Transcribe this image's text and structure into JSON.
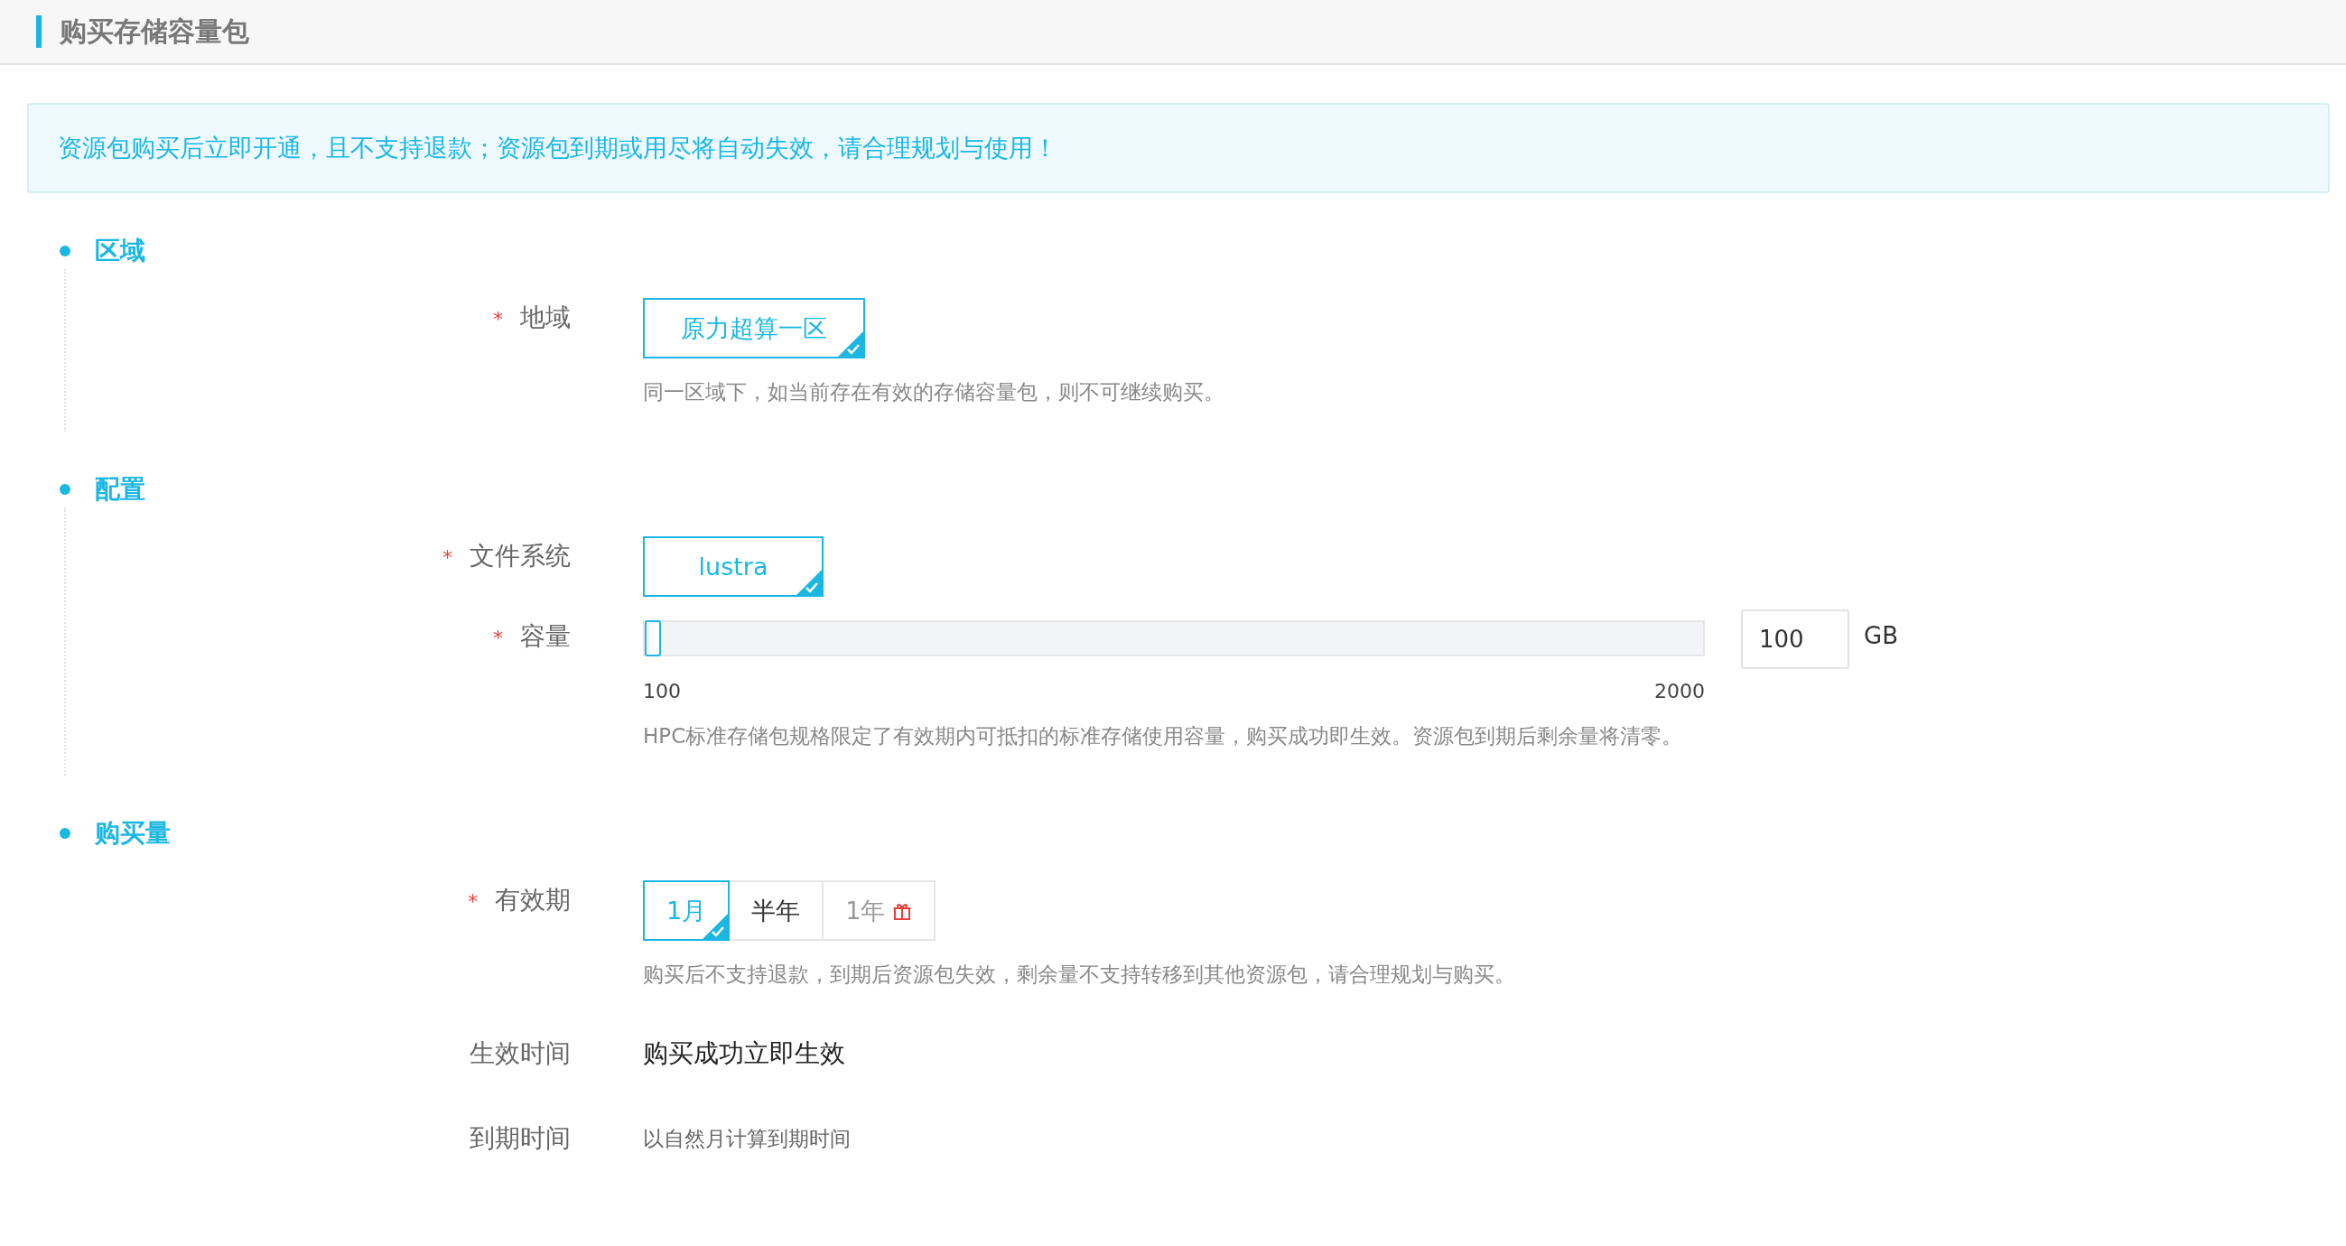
{
  "page_title": "购买存储容量包",
  "notice": "资源包购买后立即开通，且不支持退款；资源包到期或用尽将自动失效，请合理规划与使用！",
  "sections": [
    {
      "title": "区域",
      "fields": [
        {
          "kind": "choice",
          "label": "地域",
          "required_mark": "*",
          "options": [
            {
              "label": "原力超算一区",
              "selected": true,
              "disabled": false,
              "gift": false
            }
          ],
          "hint": "同一区域下，如当前存在有效的存储容量包，则不可继续购买。"
        }
      ]
    },
    {
      "title": "配置",
      "fields": [
        {
          "kind": "choice",
          "label": "文件系统",
          "required_mark": "*",
          "options": [
            {
              "label": "lustra",
              "selected": true,
              "disabled": false,
              "gift": false
            }
          ]
        },
        {
          "kind": "slider",
          "label": "容量",
          "required_mark": "*",
          "level": 0,
          "min_label": "100",
          "max_label": "2000",
          "value": "100",
          "unit": "GB",
          "hint": "HPC标准存储包规格限定了有效期内可抵扣的标准存储使用容量，购买成功即生效。资源包到期后剩余量将清零。"
        }
      ]
    },
    {
      "title": "购买量",
      "fields": [
        {
          "kind": "choice",
          "label": "有效期",
          "required_mark": "*",
          "options": [
            {
              "label": "1月",
              "selected": true,
              "disabled": false,
              "gift": false
            },
            {
              "label": "半年",
              "selected": false,
              "disabled": false,
              "gift": false
            },
            {
              "label": "1年",
              "selected": false,
              "disabled": true,
              "gift": true
            }
          ],
          "hint": "购买后不支持退款，到期后资源包失效，剩余量不支持转移到其他资源包，请合理规划与购买。"
        },
        {
          "kind": "value",
          "label": "生效时间",
          "value": "购买成功立即生效"
        },
        {
          "kind": "note",
          "label": "到期时间",
          "value": "以自然月计算到期时间"
        }
      ]
    }
  ]
}
